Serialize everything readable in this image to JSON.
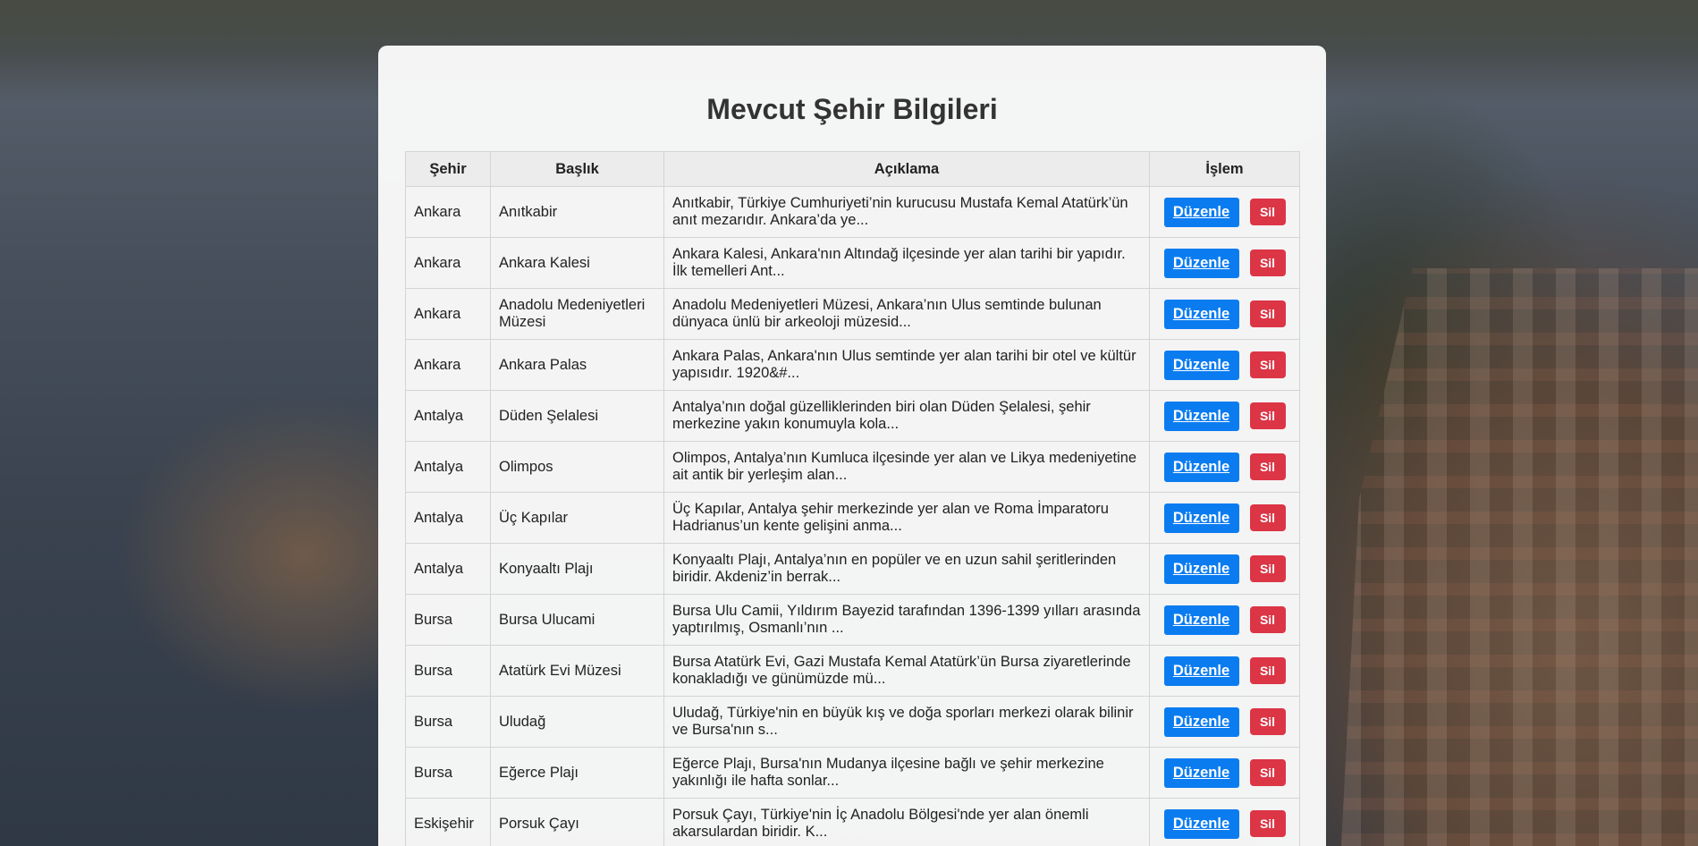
{
  "page": {
    "title": "Mevcut Şehir Bilgileri"
  },
  "table": {
    "headers": [
      "Şehir",
      "Başlık",
      "Açıklama",
      "İşlem"
    ],
    "edit_label": "Düzenle",
    "delete_label": "Sil",
    "rows": [
      {
        "city": "Ankara",
        "title": "Anıtkabir",
        "desc": "Anıtkabir, Türkiye Cumhuriyeti’nin kurucusu Mustafa Kemal Atatürk’ün anıt mezarıdır. Ankara’da ye..."
      },
      {
        "city": "Ankara",
        "title": "Ankara Kalesi",
        "desc": "Ankara Kalesi, Ankara'nın Altındağ ilçesinde yer alan tarihi bir yapıdır. İlk temelleri Ant..."
      },
      {
        "city": "Ankara",
        "title": "Anadolu Medeniyetleri Müzesi",
        "desc": "Anadolu Medeniyetleri Müzesi, Ankara’nın Ulus semtinde bulunan dünyaca ünlü bir arkeoloji müzesid..."
      },
      {
        "city": "Ankara",
        "title": "Ankara Palas",
        "desc": "Ankara Palas, Ankara'nın Ulus semtinde yer alan tarihi bir otel ve kültür yapısıdır. 1920&#..."
      },
      {
        "city": "Antalya",
        "title": "Düden Şelalesi",
        "desc": "Antalya’nın doğal güzelliklerinden biri olan Düden Şelalesi, şehir merkezine yakın konumuyla kola..."
      },
      {
        "city": "Antalya",
        "title": "Olimpos",
        "desc": "Olimpos, Antalya’nın Kumluca ilçesinde yer alan ve Likya medeniyetine ait antik bir yerleşim alan..."
      },
      {
        "city": "Antalya",
        "title": "Üç Kapılar",
        "desc": "Üç Kapılar, Antalya şehir merkezinde yer alan ve Roma İmparatoru Hadrianus’un kente gelişini anma..."
      },
      {
        "city": "Antalya",
        "title": "Konyaaltı Plajı",
        "desc": "Konyaaltı Plajı, Antalya’nın en popüler ve en uzun sahil şeritlerinden biridir. Akdeniz’in berrak..."
      },
      {
        "city": "Bursa",
        "title": "Bursa Ulucami",
        "desc": "Bursa Ulu Camii, Yıldırım Bayezid tarafından 1396-1399 yılları arasında yaptırılmış, Osmanlı’nın ..."
      },
      {
        "city": "Bursa",
        "title": "Atatürk Evi Müzesi",
        "desc": "Bursa Atatürk Evi, Gazi Mustafa Kemal Atatürk’ün Bursa ziyaretlerinde konakladığı ve günümüzde mü..."
      },
      {
        "city": "Bursa",
        "title": "Uludağ",
        "desc": "Uludağ, Türkiye'nin en büyük kış ve doğa sporları merkezi olarak bilinir ve Bursa'nın s..."
      },
      {
        "city": "Bursa",
        "title": "Eğerce Plajı",
        "desc": "Eğerce Plajı, Bursa'nın Mudanya ilçesine bağlı ve şehir merkezine yakınlığı ile hafta sonlar..."
      },
      {
        "city": "Eskişehir",
        "title": "Porsuk Çayı",
        "desc": "Porsuk Çayı, Türkiye'nin İç Anadolu Bölgesi'nde yer alan önemli akarsulardan biridir. K..."
      }
    ]
  }
}
